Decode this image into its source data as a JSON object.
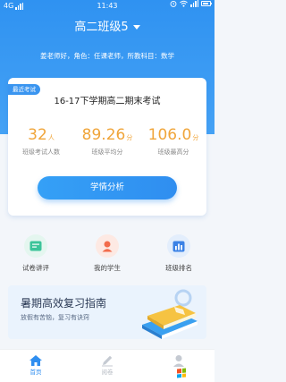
{
  "status_bar": {
    "network": "4G",
    "time": "11:43"
  },
  "header": {
    "class_name": "高二班级5",
    "teacher_info": "姜老师好，角色：任课老师，所教科目：数学"
  },
  "exam_card": {
    "tag": "最近考试",
    "exam_name": "16-17下学期高二期末考试",
    "stats": [
      {
        "value": "32",
        "unit": "人",
        "label": "班级考试人数"
      },
      {
        "value": "89.26",
        "unit": "分",
        "label": "班级平均分"
      },
      {
        "value": "106.0",
        "unit": "分",
        "label": "班级最高分"
      }
    ],
    "button_label": "学情分析"
  },
  "quick_actions": [
    {
      "label": "试卷讲评",
      "icon": "paper-review-icon"
    },
    {
      "label": "我的学生",
      "icon": "student-icon"
    },
    {
      "label": "班级排名",
      "icon": "ranking-icon"
    }
  ],
  "banner": {
    "title": "暑期高效复习指南",
    "subtitle": "放假有苦恼，复习有诀窍"
  },
  "tabbar": {
    "items": [
      {
        "label": "首页",
        "icon": "home-icon",
        "active": true
      },
      {
        "label": "阅卷",
        "icon": "pen-icon",
        "active": false
      },
      {
        "label": "",
        "icon": "profile-icon",
        "active": false
      }
    ]
  },
  "colors": {
    "primary": "#2f8ef0",
    "accent_orange": "#f0a53a",
    "background": "#f3f6fa"
  }
}
